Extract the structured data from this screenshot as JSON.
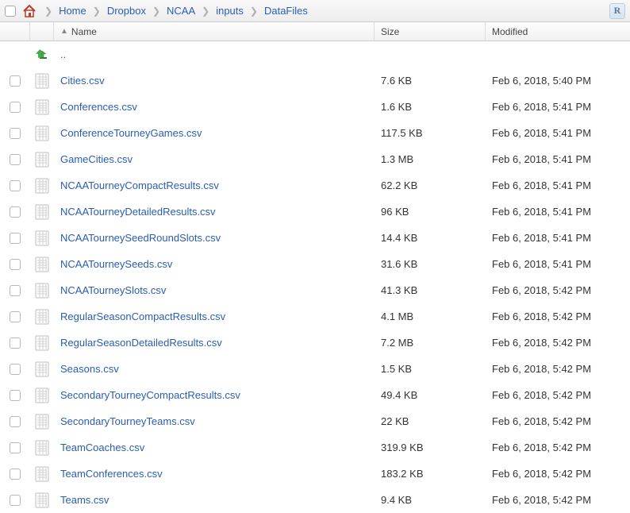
{
  "breadcrumb": [
    {
      "label": "Home"
    },
    {
      "label": "Dropbox"
    },
    {
      "label": "NCAA"
    },
    {
      "label": "inputs"
    },
    {
      "label": "DataFiles"
    }
  ],
  "r_badge": "R",
  "headers": {
    "name": "Name",
    "size": "Size",
    "modified": "Modified"
  },
  "parent_label": "..",
  "files": [
    {
      "name": "Cities.csv",
      "size": "7.6 KB",
      "modified": "Feb 6, 2018, 5:40 PM"
    },
    {
      "name": "Conferences.csv",
      "size": "1.6 KB",
      "modified": "Feb 6, 2018, 5:41 PM"
    },
    {
      "name": "ConferenceTourneyGames.csv",
      "size": "117.5 KB",
      "modified": "Feb 6, 2018, 5:41 PM"
    },
    {
      "name": "GameCities.csv",
      "size": "1.3 MB",
      "modified": "Feb 6, 2018, 5:41 PM"
    },
    {
      "name": "NCAATourneyCompactResults.csv",
      "size": "62.2 KB",
      "modified": "Feb 6, 2018, 5:41 PM"
    },
    {
      "name": "NCAATourneyDetailedResults.csv",
      "size": "96 KB",
      "modified": "Feb 6, 2018, 5:41 PM"
    },
    {
      "name": "NCAATourneySeedRoundSlots.csv",
      "size": "14.4 KB",
      "modified": "Feb 6, 2018, 5:41 PM"
    },
    {
      "name": "NCAATourneySeeds.csv",
      "size": "31.6 KB",
      "modified": "Feb 6, 2018, 5:41 PM"
    },
    {
      "name": "NCAATourneySlots.csv",
      "size": "41.3 KB",
      "modified": "Feb 6, 2018, 5:42 PM"
    },
    {
      "name": "RegularSeasonCompactResults.csv",
      "size": "4.1 MB",
      "modified": "Feb 6, 2018, 5:42 PM"
    },
    {
      "name": "RegularSeasonDetailedResults.csv",
      "size": "7.2 MB",
      "modified": "Feb 6, 2018, 5:42 PM"
    },
    {
      "name": "Seasons.csv",
      "size": "1.5 KB",
      "modified": "Feb 6, 2018, 5:42 PM"
    },
    {
      "name": "SecondaryTourneyCompactResults.csv",
      "size": "49.4 KB",
      "modified": "Feb 6, 2018, 5:42 PM"
    },
    {
      "name": "SecondaryTourneyTeams.csv",
      "size": "22 KB",
      "modified": "Feb 6, 2018, 5:42 PM"
    },
    {
      "name": "TeamCoaches.csv",
      "size": "319.9 KB",
      "modified": "Feb 6, 2018, 5:42 PM"
    },
    {
      "name": "TeamConferences.csv",
      "size": "183.2 KB",
      "modified": "Feb 6, 2018, 5:42 PM"
    },
    {
      "name": "Teams.csv",
      "size": "9.4 KB",
      "modified": "Feb 6, 2018, 5:42 PM"
    }
  ]
}
